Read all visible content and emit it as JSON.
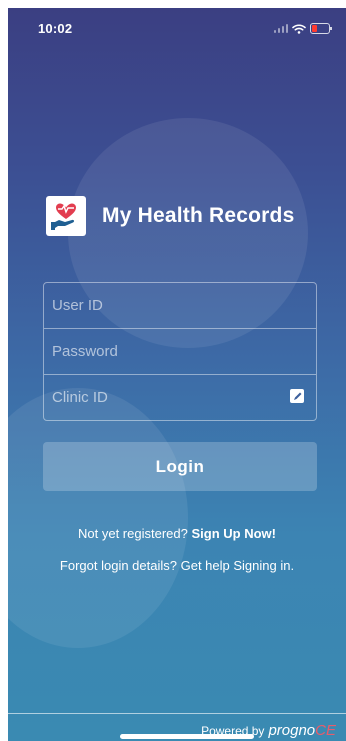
{
  "status_bar": {
    "time": "10:02"
  },
  "app": {
    "name": "My Health Records"
  },
  "login_form": {
    "user_id_placeholder": "User ID",
    "password_placeholder": "Password",
    "clinic_id_placeholder": "Clinic ID",
    "login_label": "Login"
  },
  "links": {
    "register_prompt": "Not yet registered?",
    "sign_up_label": "Sign Up Now!",
    "forgot_text": "Forgot login details? Get help Signing in."
  },
  "footer": {
    "powered_by": "Powered by",
    "brand_main": "progno",
    "brand_accent": "CE"
  },
  "colors": {
    "accent": "#e85c6b",
    "background_top": "#3b3f82",
    "background_bottom": "#3a8ab2"
  }
}
